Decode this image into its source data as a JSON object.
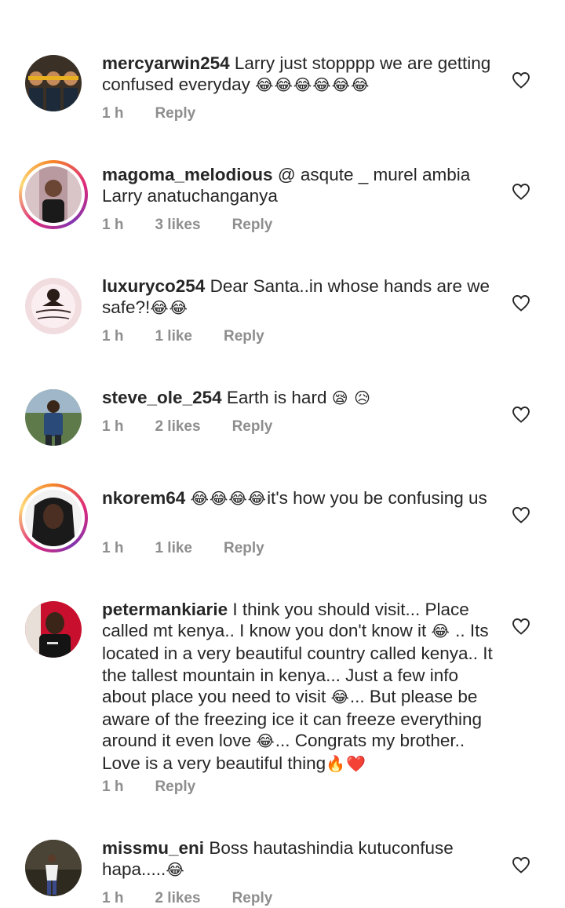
{
  "colors": {
    "text": "#262626",
    "meta": "#8e8e8e",
    "ring_start": "#f58529",
    "ring_mid": "#dd2a7b",
    "ring_end": "#8134af"
  },
  "comments": [
    {
      "username": "mercyarwin254",
      "text": "Larry just stopppp  we are getting confused everyday",
      "emoji": "😂😂😂😂😂😂",
      "time": "1 h",
      "likes": "",
      "reply": "Reply",
      "avatar": "three-selfie-photo",
      "story_ring": false
    },
    {
      "username": "magoma_melodious",
      "text": "@ asqute _ murel ambia Larry anatuchanganya",
      "emoji": "",
      "time": "1 h",
      "likes": "3 likes",
      "reply": "Reply",
      "avatar": "woman-photo",
      "story_ring": true
    },
    {
      "username": "luxuryco254",
      "text": "Dear Santa..in whose hands are we safe?!",
      "emoji": "😂😂",
      "time": "1 h",
      "likes": "1 like",
      "reply": "Reply",
      "avatar": "luxury-collection-logo",
      "story_ring": false
    },
    {
      "username": "steve_ole_254",
      "text": "Earth is hard",
      "emoji": "😪 😥",
      "time": "1 h",
      "likes": "2 likes",
      "reply": "Reply",
      "avatar": "man-outdoor-photo",
      "story_ring": false
    },
    {
      "username": "nkorem64",
      "text": "it's how you be confusing us",
      "emoji": "😂😂😂😂",
      "time": "1 h",
      "likes": "1 like",
      "reply": "Reply",
      "avatar": "woman-braids-photo",
      "story_ring": true
    },
    {
      "username": "petermankiarie",
      "text_parts": [
        "I think you should visit... Place called  mt kenya.. I know you don't know it ",
        "😂",
        " .. Its located in a very beautiful country called kenya.. It the tallest mountain in kenya... Just a few info about place you need to visit ",
        "😂",
        "... But please be aware of the freezing ice it can freeze everything around it even love ",
        "😂",
        "... Congrats my brother.. Love is a very beautiful thing",
        "🔥❤️"
      ],
      "time": "1 h",
      "likes": "",
      "reply": "Reply",
      "avatar": "man-dark-shirt-photo",
      "story_ring": false
    },
    {
      "username": "missmu_eni",
      "text": "Boss hautashindia kutuconfuse hapa.....",
      "emoji": "😂",
      "time": "1 h",
      "likes": "2 likes",
      "reply": "Reply",
      "avatar": "person-standing-photo",
      "story_ring": false
    }
  ]
}
